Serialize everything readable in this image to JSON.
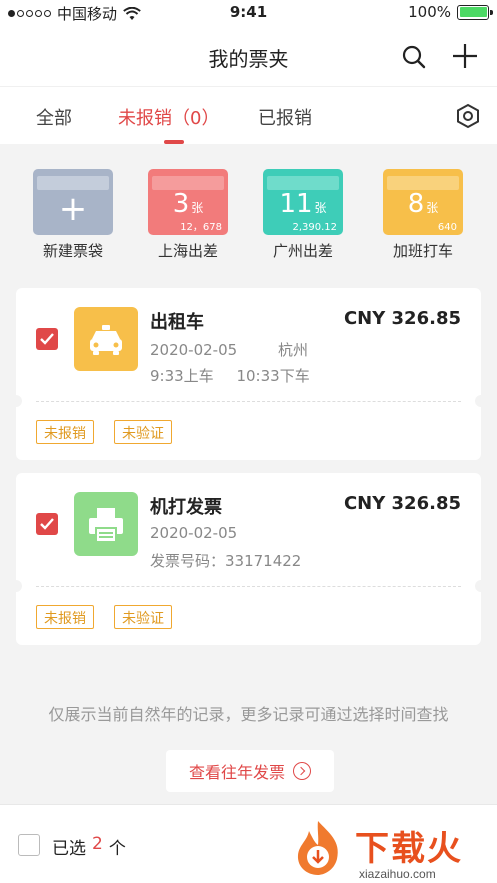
{
  "status_bar": {
    "carrier": "中国移动",
    "time": "9:41",
    "battery": "100%"
  },
  "nav": {
    "title": "我的票夹"
  },
  "tabs": [
    {
      "label": "全部"
    },
    {
      "label": "未报销（0）",
      "active": true
    },
    {
      "label": "已报销"
    }
  ],
  "bags": [
    {
      "label": "新建票袋",
      "icon": "plus-icon",
      "color": "#a8b4c8"
    },
    {
      "label": "上海出差",
      "count": "3",
      "unit": "张",
      "amount": "12，678",
      "color": "#f27b7b"
    },
    {
      "label": "广州出差",
      "count": "11",
      "unit": "张",
      "amount": "2,390.12",
      "color": "#3ecdb8"
    },
    {
      "label": "加班打车",
      "count": "8",
      "unit": "张",
      "amount": "640",
      "color": "#f7bf4a"
    }
  ],
  "invoices": [
    {
      "title": "出租车",
      "amount": "CNY 326.85",
      "date": "2020-02-05",
      "city": "杭州",
      "board": "9:33上车",
      "alight": "10:33下车",
      "tags": [
        "未报销",
        "未验证"
      ],
      "icon": "taxi-icon",
      "checked": true,
      "color": "#f7bf4a"
    },
    {
      "title": "机打发票",
      "amount": "CNY 326.85",
      "date": "2020-02-05",
      "invoice_no": "发票号码：33171422",
      "tags": [
        "未报销",
        "未验证"
      ],
      "icon": "printer-icon",
      "checked": true,
      "color": "#8fdb8a"
    }
  ],
  "footer": {
    "note": "仅展示当前自然年的记录，更多记录可通过选择时间查找",
    "history_button": "查看往年发票"
  },
  "bottom": {
    "selected_prefix": "已选",
    "selected_count": "2",
    "selected_suffix": "个"
  },
  "watermark": {
    "text": "下载火",
    "url": "xiazaihuo.com"
  },
  "colors": {
    "accent": "#e04848",
    "tag": "#f0a830",
    "background": "#f3f3f3"
  }
}
